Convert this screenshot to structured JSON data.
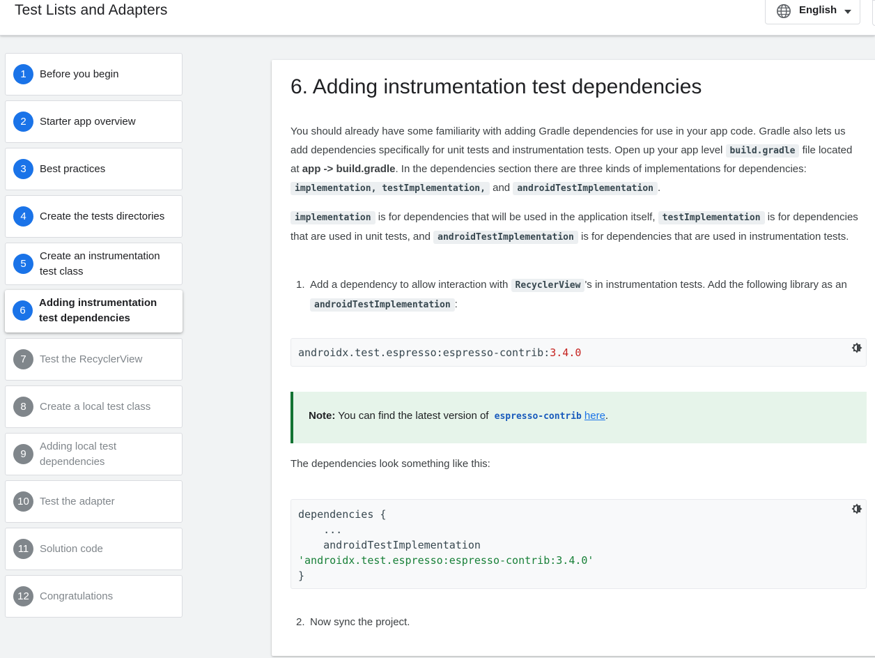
{
  "header": {
    "title": "Test Lists and Adapters",
    "language": "English",
    "language_icon": "globe-icon"
  },
  "steps": [
    {
      "num": "1",
      "label": "Before you begin"
    },
    {
      "num": "2",
      "label": "Starter app overview"
    },
    {
      "num": "3",
      "label": "Best practices"
    },
    {
      "num": "4",
      "label": "Create the tests directories"
    },
    {
      "num": "5",
      "label": "Create an instrumentation test class"
    },
    {
      "num": "6",
      "label": "Adding instrumentation test dependencies"
    },
    {
      "num": "7",
      "label": "Test the RecyclerView"
    },
    {
      "num": "8",
      "label": "Create a local test class"
    },
    {
      "num": "9",
      "label": "Adding local test dependencies"
    },
    {
      "num": "10",
      "label": "Test the adapter"
    },
    {
      "num": "11",
      "label": "Solution code"
    },
    {
      "num": "12",
      "label": "Congratulations"
    }
  ],
  "content": {
    "title": "6. Adding instrumentation test dependencies",
    "p1": {
      "t1": "You should already have some familiarity with adding Gradle dependencies for use in your app code. Gradle also lets us add dependencies specifically for unit tests and instrumentation tests. Open up your app level ",
      "c1": "build.gradle",
      "t2": " file located at ",
      "b1": "app -> build.gradle",
      "t3": ". In the dependencies section there are three kinds of implementations for dependencies: ",
      "c2": "implementation, testImplementation,",
      "t4": " and ",
      "c3": "androidTestImplementation",
      "t5": "."
    },
    "p2": {
      "c1": "implementation",
      "t1": " is for dependencies that will be used in the application itself, ",
      "c2": "testImplementation",
      "t2": " is for dependencies that are used in unit tests, and ",
      "c3": "androidTestImplementation",
      "t3": " is for dependencies that are used in instrumentation tests."
    },
    "step1": {
      "num": "1.",
      "t1": "Add a dependency to allow interaction with ",
      "c1": "RecyclerView",
      "t2": "'s in instrumentation tests. Add the following library as an ",
      "c2": "androidTestImplementation",
      "t3": ":"
    },
    "code1": {
      "prefix": "androidx.test.espresso:espresso-contrib:",
      "version": "3.4.0"
    },
    "note": {
      "bold": "Note:",
      "text": " You can find the latest version of ",
      "code": "espresso-contrib",
      "link": "here",
      "end": "."
    },
    "p3": "The dependencies look something like this:",
    "code2": {
      "line1": "dependencies {",
      "line2": "    ...",
      "line3": "    androidTestImplementation",
      "line4": "'androidx.test.espresso:espresso-contrib:3.4.0'",
      "line5": "}"
    },
    "step2": {
      "num": "2.",
      "text": "Now sync the project."
    }
  }
}
